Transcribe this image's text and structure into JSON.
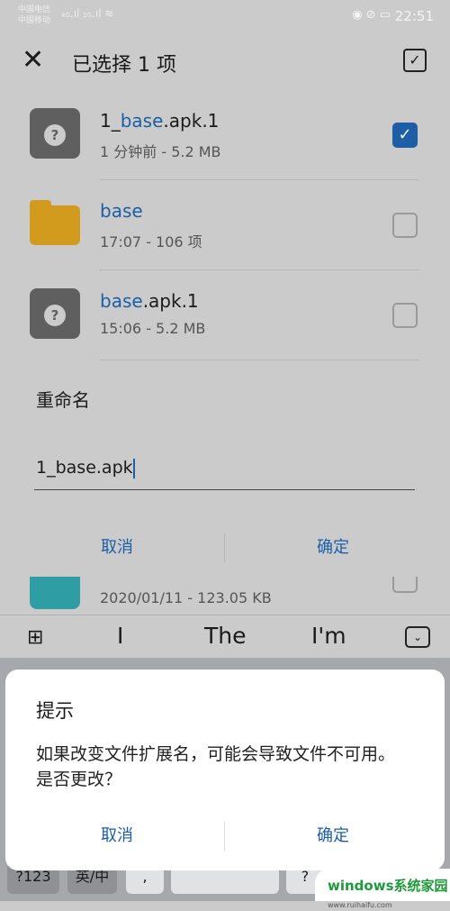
{
  "status": {
    "carrier1": "中国电信",
    "carrier2": "中国移动",
    "net1": "4G",
    "net2": "2G",
    "time": "22:51"
  },
  "topbar": {
    "title": "已选择 1 项"
  },
  "files": [
    {
      "name_prefix": "1_",
      "name_match": "base",
      "name_suffix": ".apk.1",
      "meta": "1 分钟前 - 5.2 MB",
      "type": "unknown",
      "checked": true
    },
    {
      "name_prefix": "",
      "name_match": "base",
      "name_suffix": "",
      "meta": "17:07 - 106 项",
      "type": "folder",
      "checked": false
    },
    {
      "name_prefix": "",
      "name_match": "base",
      "name_suffix": ".apk.1",
      "meta": "15:06 - 5.2 MB",
      "type": "unknown",
      "checked": false
    },
    {
      "meta": "2020/01/11 - 123.05 KB",
      "type": "document",
      "checked": false
    }
  ],
  "rename": {
    "title": "重命名",
    "value": "1_base.apk",
    "cancel": "取消",
    "ok": "确定"
  },
  "suggestions": [
    "I",
    "The",
    "I'm"
  ],
  "keyboard": {
    "k1": "?123",
    "k2": "英/中",
    "k3": ",",
    "k5": "?"
  },
  "alert": {
    "title": "提示",
    "message": "如果改变文件扩展名，可能会导致文件不可用。是否更改？",
    "cancel": "取消",
    "ok": "确定"
  },
  "watermark": {
    "brand": "windows系统家园",
    "url": "www.ruihaifu.com"
  },
  "colors": {
    "accent": "#1d5ea6",
    "folder": "#d29b1e",
    "dim_bg": "#cbcbcb"
  }
}
